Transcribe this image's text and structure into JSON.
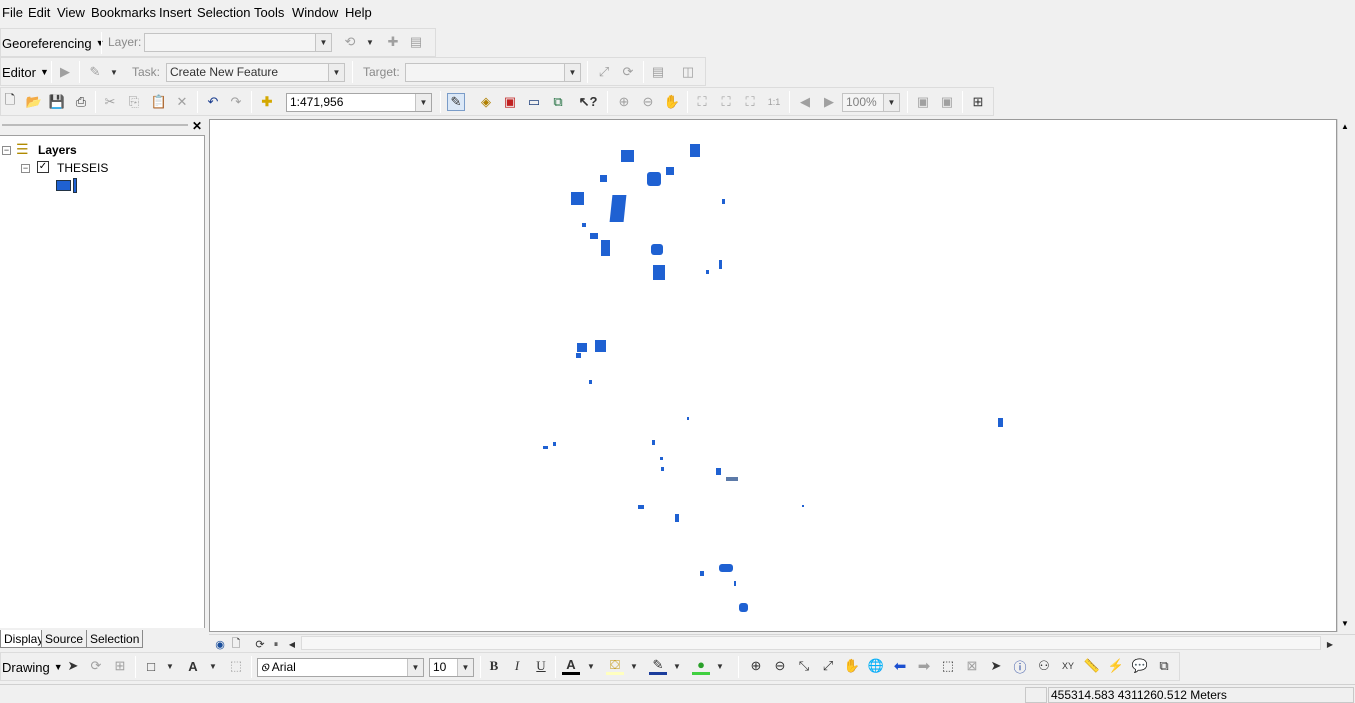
{
  "menu": [
    "File",
    "Edit",
    "View",
    "Bookmarks",
    "Insert",
    "Selection",
    "Tools",
    "Window",
    "Help"
  ],
  "georef": {
    "label": "Georeferencing",
    "layer_label": "Layer:",
    "layer_value": ""
  },
  "editor": {
    "label": "Editor",
    "task_label": "Task:",
    "task_value": "Create New Feature",
    "target_label": "Target:",
    "target_value": ""
  },
  "standard": {
    "scale": "1:471,956",
    "zoom_pct": "100%"
  },
  "toc": {
    "root": "Layers",
    "layer_name": "THESEIS",
    "layer_checked": true
  },
  "tabs": [
    "Display",
    "Source",
    "Selection"
  ],
  "drawing": {
    "label": "Drawing",
    "font": "Arial",
    "font_size": "10",
    "bold": "B",
    "italic": "I",
    "underline": "U"
  },
  "status": {
    "coords": "455314.583  4311260.512 Meters"
  },
  "colors": {
    "feature_fill": "#1f61d2",
    "map_bg": "#ffffff"
  },
  "icons": [
    "new-icon",
    "open-icon",
    "save-icon",
    "print-icon",
    "cut-icon",
    "copy-icon",
    "paste-icon",
    "delete-icon",
    "undo-icon",
    "redo-icon",
    "add-data-icon",
    "editor-toolbar-icon",
    "arctoolbox-icon",
    "catalog-icon",
    "python-window-icon",
    "model-builder-icon",
    "whats-this-icon",
    "zoom-in-icon",
    "zoom-out-icon",
    "pan-icon",
    "full-extent-icon",
    "globe-icon",
    "identify-icon",
    "find-icon",
    "select-arrow-icon"
  ]
}
